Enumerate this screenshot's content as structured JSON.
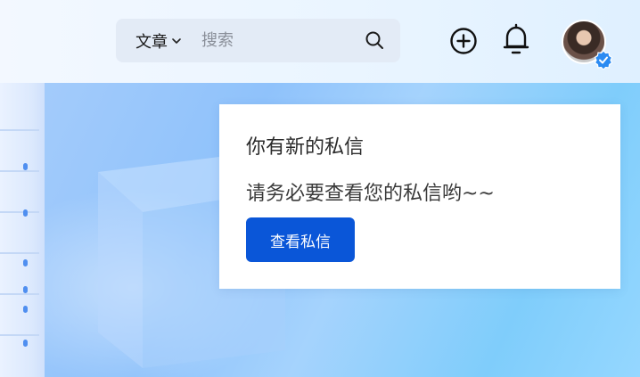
{
  "header": {
    "search": {
      "type_label": "文章",
      "placeholder": "搜索"
    }
  },
  "icons": {
    "search": "search-icon",
    "type_chevron": "chevron-down-icon",
    "create": "plus-circle-icon",
    "notifications": "bell-icon",
    "verified": "verified-badge-icon"
  },
  "message_card": {
    "title": "你有新的私信",
    "body": "请务必要查看您的私信哟~~",
    "button_label": "查看私信"
  },
  "colors": {
    "primary": "#0a56d8",
    "verified_badge": "#2b8bf2",
    "search_bg": "#e3ebf6",
    "hero_blue": "#8fc2fb"
  }
}
